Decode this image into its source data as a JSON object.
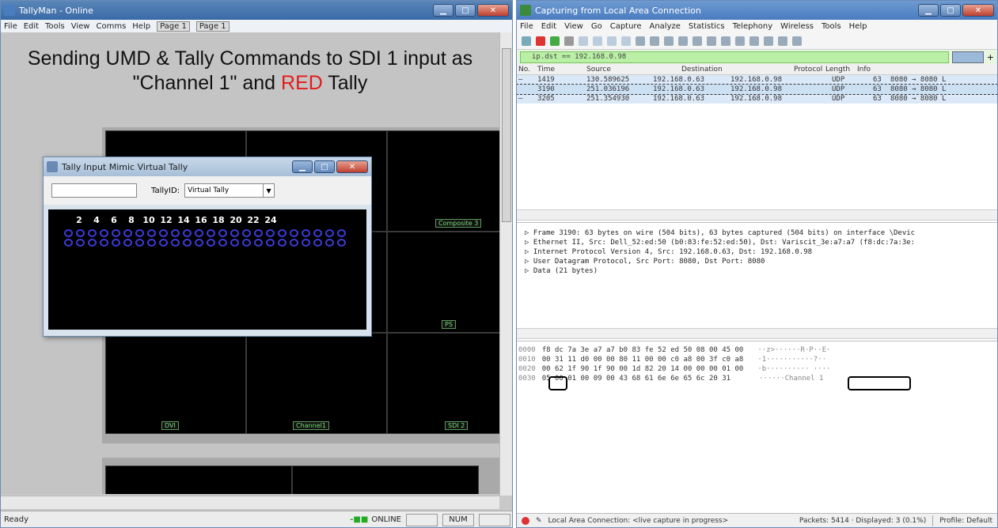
{
  "tallyman": {
    "title": "TallyMan - Online",
    "menu": [
      "File",
      "Edit",
      "Tools",
      "View",
      "Comms",
      "Help"
    ],
    "pages": [
      "Page 1",
      "Page 1"
    ],
    "heading_line1": "Sending UMD & Tally Commands to SDI 1 input as",
    "heading_line2_pre": "\"Channel 1\" and ",
    "heading_line2_red": "RED",
    "heading_line2_post": " Tally",
    "cell_labels": {
      "composite3": "Composite 3",
      "ps": "PS",
      "dvi": "DVI",
      "channel1": "Channel1",
      "sdi2": "SDI 2"
    },
    "status_ready": "Ready",
    "status_online": "ONLINE",
    "status_num": "NUM"
  },
  "popup": {
    "title": "Tally Input Mimic Virtual Tally",
    "tally_id_label": "TallyID:",
    "tally_id_value": "Virtual Tally",
    "numbers": [
      "2",
      "4",
      "6",
      "8",
      "10",
      "12",
      "14",
      "16",
      "18",
      "20",
      "22",
      "24"
    ]
  },
  "wireshark": {
    "title": "Capturing from Local Area Connection",
    "menu": [
      "File",
      "Edit",
      "View",
      "Go",
      "Capture",
      "Analyze",
      "Statistics",
      "Telephony",
      "Wireless",
      "Tools",
      "Help"
    ],
    "filter": "ip.dst == 192.168.0.98",
    "columns": [
      "No.",
      "Time",
      "Source",
      "Destination",
      "Protocol",
      "Length",
      "Info"
    ],
    "packets": [
      {
        "no": "1419",
        "time": "130.589625",
        "src": "192.168.0.63",
        "dst": "192.168.0.98",
        "proto": "UDP",
        "len": "63",
        "info": "8080 → 8080 L"
      },
      {
        "no": "3190",
        "time": "251.036196",
        "src": "192.168.0.63",
        "dst": "192.168.0.98",
        "proto": "UDP",
        "len": "63",
        "info": "8080 → 8080 L"
      },
      {
        "no": "3205",
        "time": "251.354930",
        "src": "192.168.0.63",
        "dst": "192.168.0.98",
        "proto": "UDP",
        "len": "63",
        "info": "8080 → 8080 L"
      }
    ],
    "details": [
      "▷ Frame 3190: 63 bytes on wire (504 bits), 63 bytes captured (504 bits) on interface \\Devic",
      "▷ Ethernet II, Src: Dell_52:ed:50 (b0:83:fe:52:ed:50), Dst: Variscit_3e:a7:a7 (f8:dc:7a:3e:",
      "▷ Internet Protocol Version 4, Src: 192.168.0.63, Dst: 192.168.0.98",
      "▷ User Datagram Protocol, Src Port: 8080, Dst Port: 8080",
      "▷ Data (21 bytes)"
    ],
    "hex": [
      {
        "off": "0000",
        "bytes": "f8 dc 7a 3e a7 a7 b0 83  fe 52 ed 50 08 00 45 00",
        "ascii": "··z>······R·P··E·"
      },
      {
        "off": "0010",
        "bytes": "00 31 11 d0 00 00 80 11  00 00 c0 a8 00 3f c0 a8",
        "ascii": "·1···········?··"
      },
      {
        "off": "0020",
        "bytes": "00 62 1f 90 1f 90 00 1d  82 20 14 00 00 00 01 00",
        "ascii": "·b·········· ····"
      },
      {
        "off": "0030",
        "bytes": "05 00 01 00 09 00 43 68  61 6e 6e 65 6c 20 31",
        "ascii": "······Channel 1"
      }
    ],
    "status_iface": "Local Area Connection: <live capture in progress>",
    "status_packets": "Packets: 5414 · Displayed: 3 (0.1%)",
    "status_profile": "Profile: Default"
  }
}
